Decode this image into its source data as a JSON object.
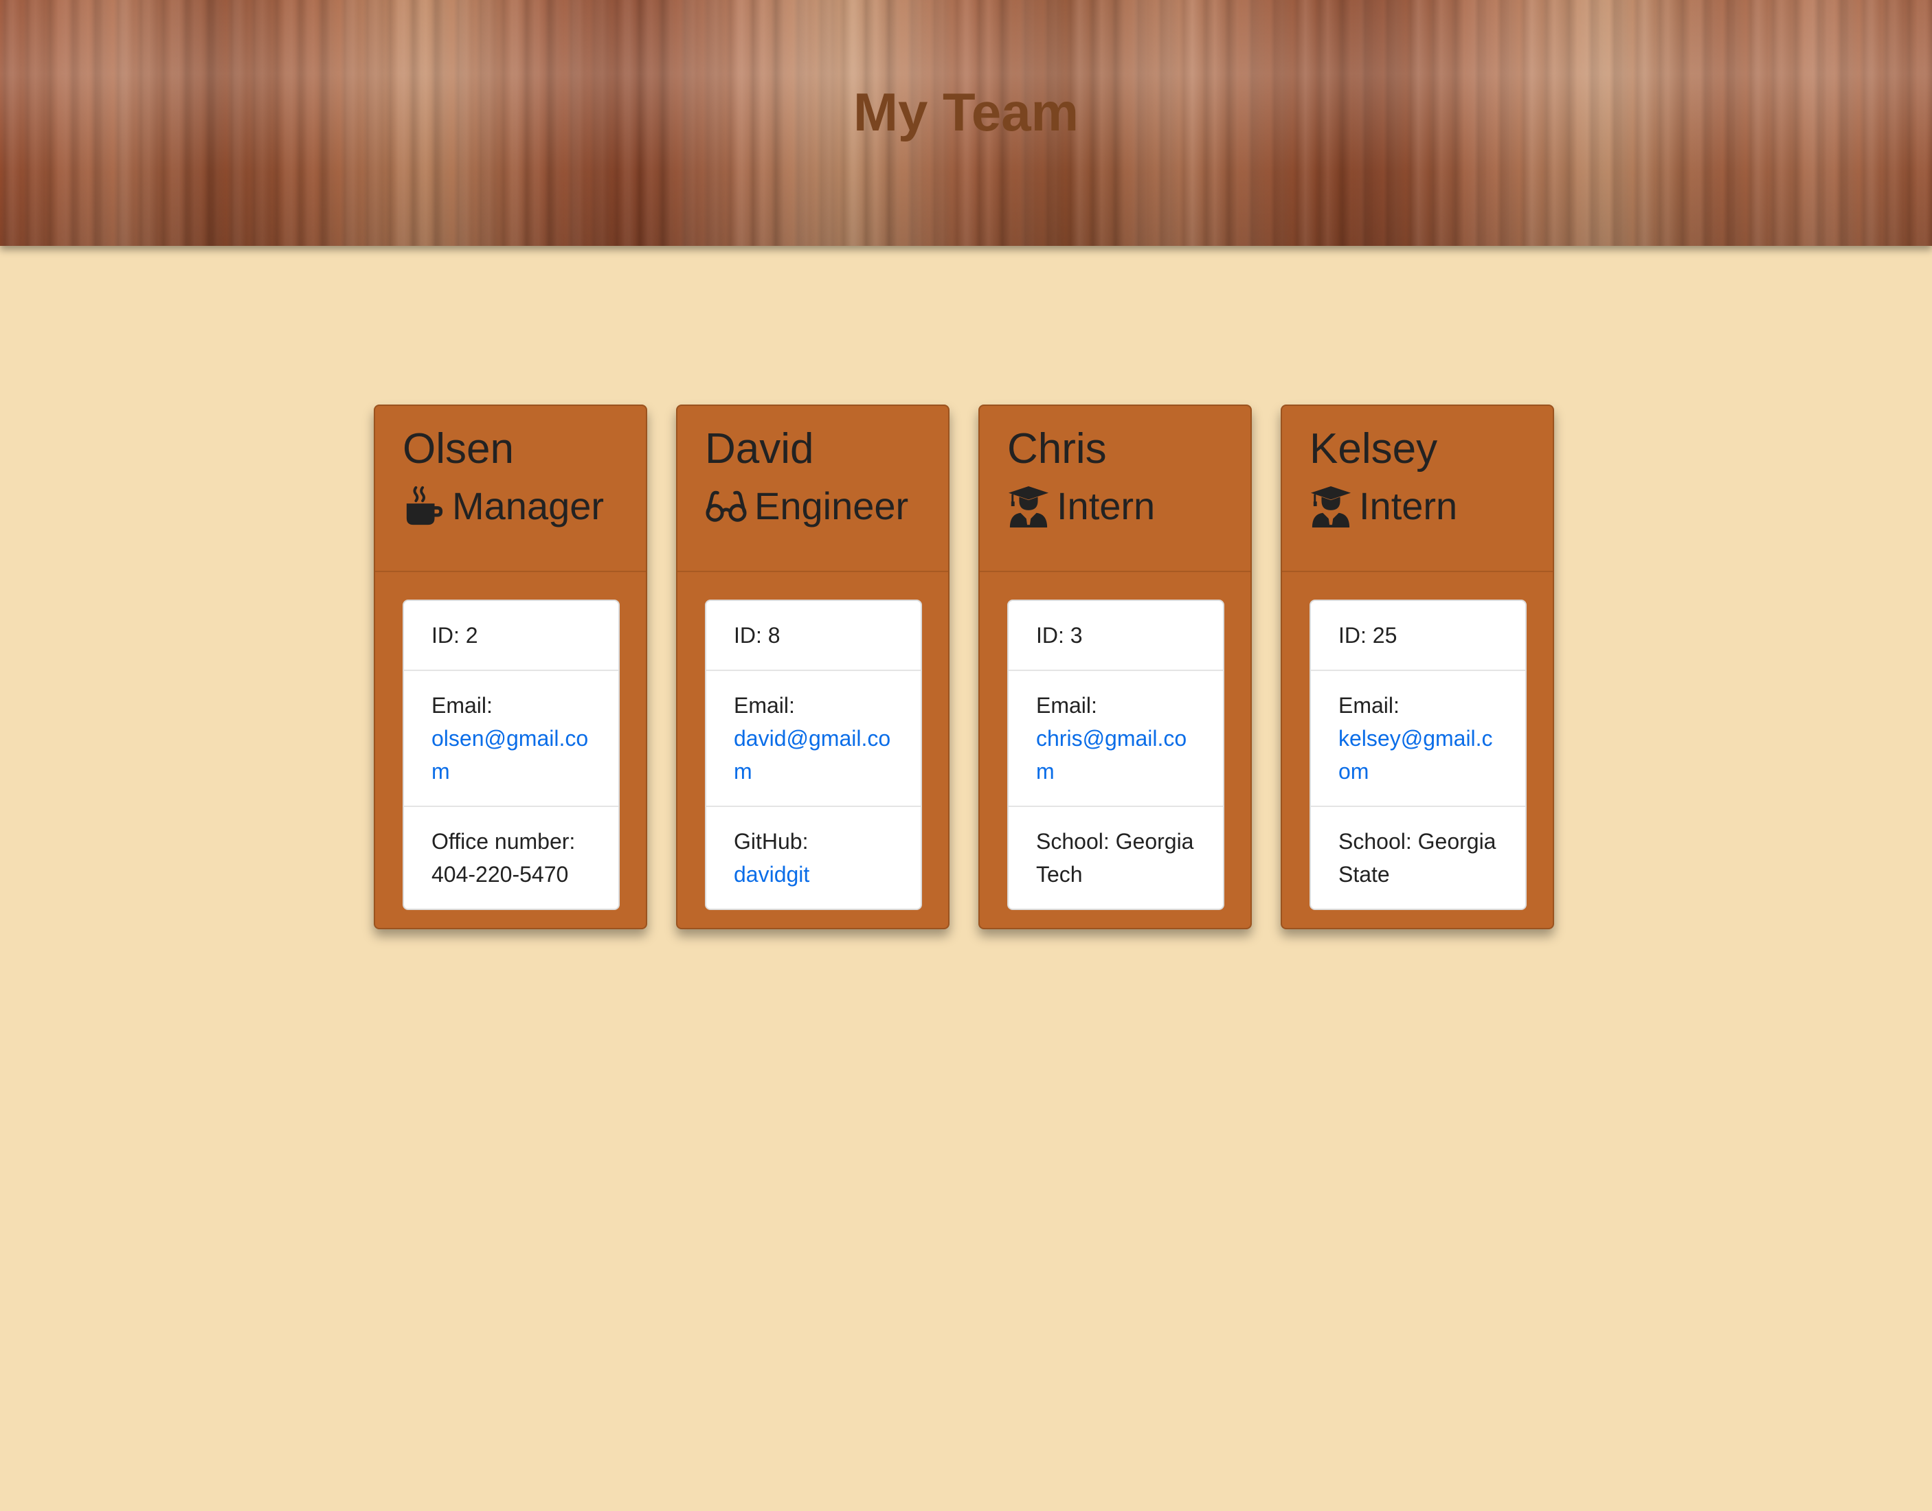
{
  "header": {
    "title": "My Team"
  },
  "colors": {
    "background": "#f5deb3",
    "card": "#bd672a",
    "link": "#0a6de8",
    "title": "#7a4520"
  },
  "employees": [
    {
      "name": "Olsen",
      "role": "Manager",
      "icon": "mug-icon",
      "id_text": "ID: 2",
      "email_label": "Email:",
      "email": "olsen@gmail.com",
      "extra_label": "Office number:",
      "extra_value": "404-220-5470"
    },
    {
      "name": "David",
      "role": "Engineer",
      "icon": "glasses-icon",
      "id_text": "ID: 8",
      "email_label": "Email:",
      "email": "david@gmail.com",
      "extra_label": "GitHub:",
      "extra_value": "davidgit"
    },
    {
      "name": "Chris",
      "role": "Intern",
      "icon": "graduate-icon",
      "id_text": "ID: 3",
      "email_label": "Email:",
      "email": "chris@gmail.com",
      "extra_label": "School:",
      "extra_value": "Georgia Tech"
    },
    {
      "name": "Kelsey",
      "role": "Intern",
      "icon": "graduate-icon",
      "id_text": "ID: 25",
      "email_label": "Email:",
      "email": "kelsey@gmail.com",
      "extra_label": "School:",
      "extra_value": "Georgia State"
    }
  ]
}
